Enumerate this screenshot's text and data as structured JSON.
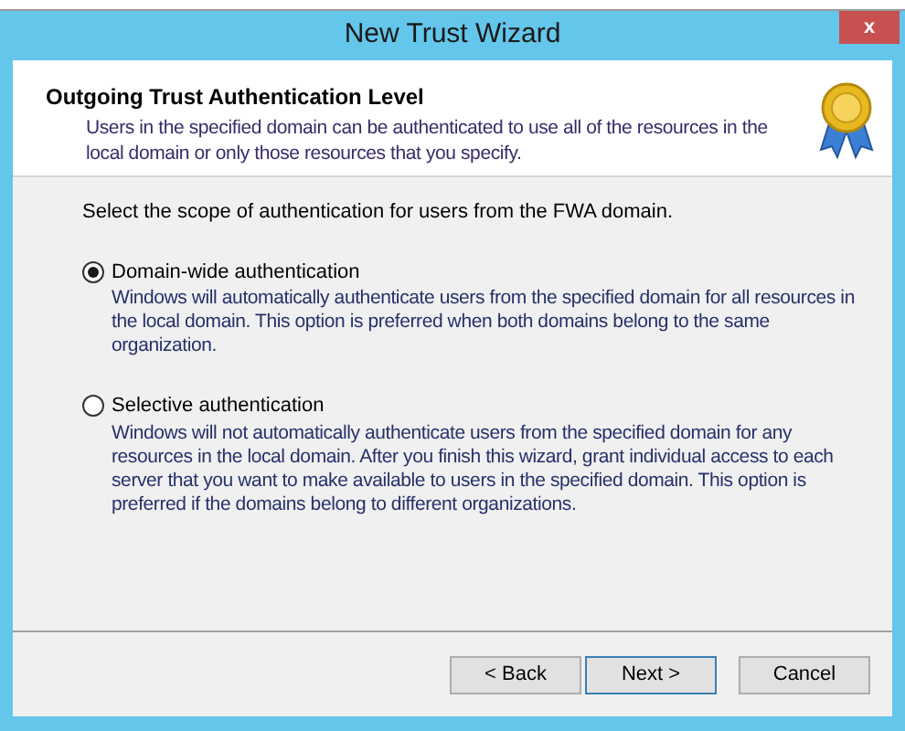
{
  "window": {
    "title": "New Trust Wizard",
    "close": "x"
  },
  "header": {
    "title": "Outgoing Trust Authentication Level",
    "description": "Users in the specified domain can be authenticated to use all of the resources in the local domain or only those resources that you specify."
  },
  "prompt": "Select the scope of authentication for users from the FWA domain.",
  "options": [
    {
      "label": "Domain-wide authentication",
      "description": "Windows will automatically authenticate users from the specified domain for all resources in the local domain. This option is preferred when both domains belong to the same organization.",
      "selected": true
    },
    {
      "label": "Selective authentication",
      "description": "Windows will not automatically authenticate users from the specified domain for any resources in the local domain. After you finish this wizard, grant individual access to each server that you want to make available to users in the specified domain. This option is preferred if the domains belong to different organizations.",
      "selected": false
    }
  ],
  "buttons": [
    {
      "label": "< Back",
      "default": false
    },
    {
      "label": "Next >",
      "default": true
    },
    {
      "label": "Cancel",
      "default": false
    }
  ]
}
